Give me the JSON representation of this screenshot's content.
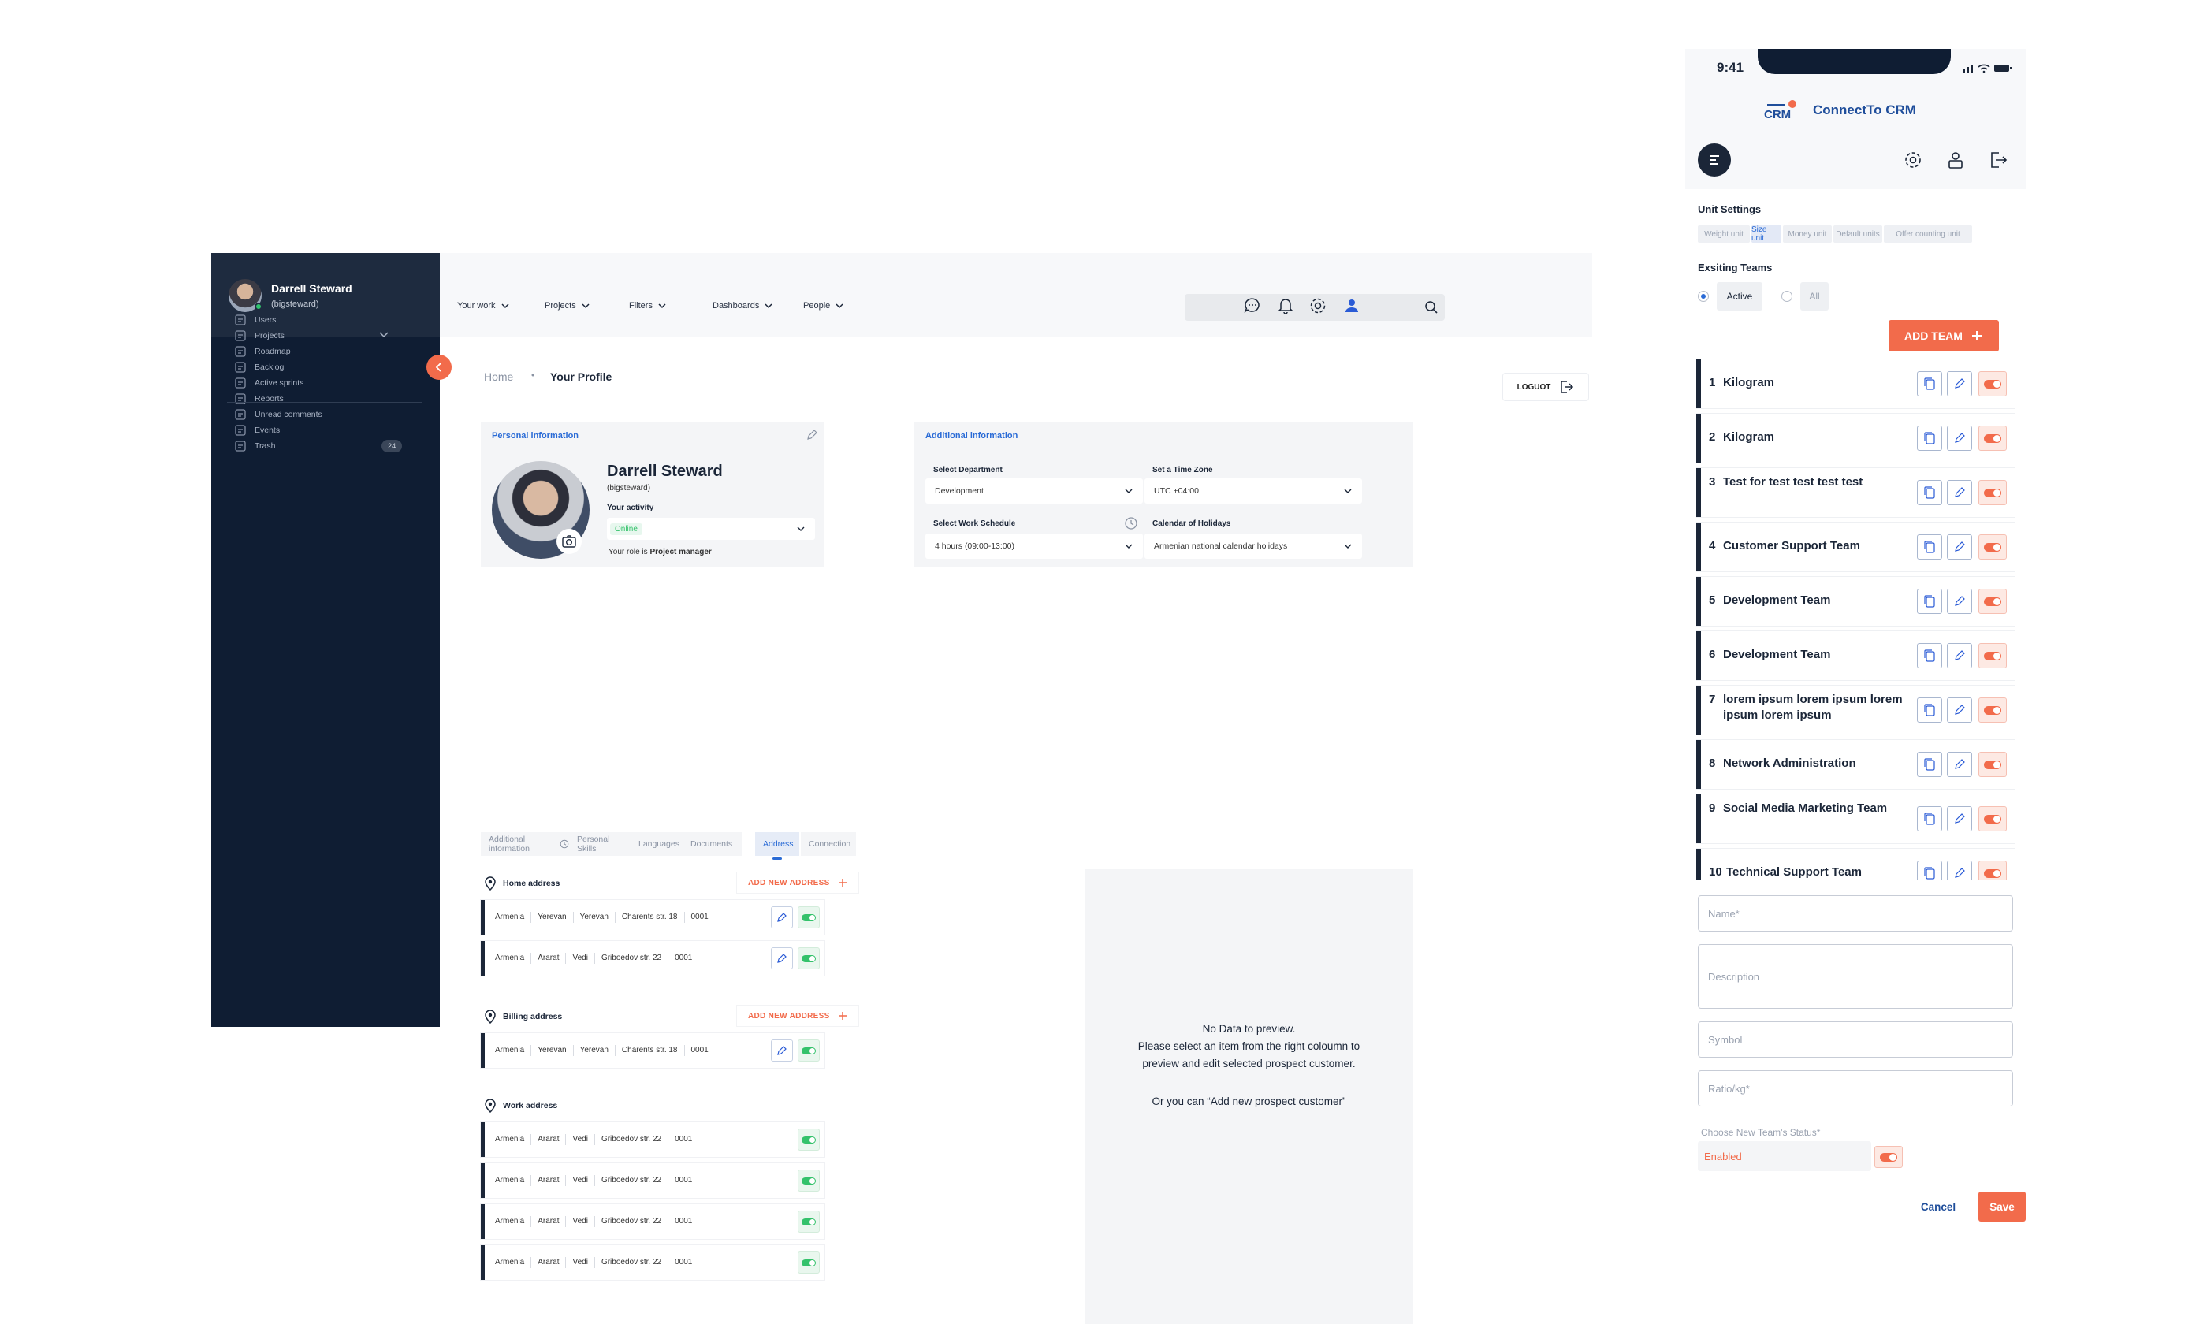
{
  "desktop": {
    "sidebar": {
      "user_name": "Darrell Steward",
      "user_handle": "(bigsteward)",
      "items": [
        {
          "label": "Users",
          "icon": "users-icon"
        },
        {
          "label": "Projects",
          "icon": "projects-icon"
        },
        {
          "label": "Roadmap",
          "icon": "roadmap-icon"
        },
        {
          "label": "Backlog",
          "icon": "backlog-icon"
        },
        {
          "label": "Active sprints",
          "icon": "sprints-icon"
        },
        {
          "label": "Reports",
          "icon": "reports-icon"
        },
        {
          "label": "Unread comments",
          "icon": "comments-icon"
        },
        {
          "label": "Events",
          "icon": "calendar-icon"
        },
        {
          "label": "Trash",
          "icon": "trash-icon",
          "badge": "24"
        }
      ]
    },
    "topbar": {
      "menu": [
        "Your work",
        "Projects",
        "Filters",
        "Dashboards",
        "People"
      ],
      "search_placeholder": ""
    },
    "breadcrumb": {
      "home": "Home",
      "separator": "•",
      "current": "Your Profile"
    },
    "logout_label": "LOGUOT",
    "personal": {
      "title": "Personal information",
      "name": "Darrell Steward",
      "handle": "(bigsteward)",
      "activity_label": "Your activity",
      "activity_value": "Online",
      "role_prefix": "Your role is ",
      "role": "Project manager"
    },
    "additional": {
      "title": "Additional information",
      "department_label": "Select Department",
      "department_value": "Development",
      "timezone_label": "Set a Time Zone",
      "timezone_value": "UTC +04:00",
      "schedule_label": "Select Work Schedule",
      "schedule_value": "4 hours (09:00-13:00)",
      "holidays_label": "Calendar of Holidays",
      "holidays_value": "Armenian national calendar holidays"
    },
    "tabs": [
      "Additional information",
      "Personal Skills",
      "Languages",
      "Documents",
      "Address",
      "Connection"
    ],
    "active_tab": "Address",
    "addresses": {
      "home_title": "Home address",
      "billing_title": "Billing address",
      "work_title": "Work address",
      "add_label": "ADD NEW ADDRESS",
      "home": [
        [
          "Armenia",
          "Yerevan",
          "Yerevan",
          "Charents str. 18",
          "0001"
        ],
        [
          "Armenia",
          "Ararat",
          "Vedi",
          "Griboedov str. 22",
          "0001"
        ]
      ],
      "billing": [
        [
          "Armenia",
          "Yerevan",
          "Yerevan",
          "Charents str. 18",
          "0001"
        ]
      ],
      "work": [
        [
          "Armenia",
          "Ararat",
          "Vedi",
          "Griboedov str. 22",
          "0001"
        ],
        [
          "Armenia",
          "Ararat",
          "Vedi",
          "Griboedov str. 22",
          "0001"
        ],
        [
          "Armenia",
          "Ararat",
          "Vedi",
          "Griboedov str. 22",
          "0001"
        ],
        [
          "Armenia",
          "Ararat",
          "Vedi",
          "Griboedov str. 22",
          "0001"
        ]
      ]
    },
    "preview": {
      "line1": "No Data to preview.",
      "line2": "Please select an item from the right coloumn to",
      "line3": "preview and edit selected prospect customer.",
      "line4": "Or you can “Add new prospect customer”"
    }
  },
  "phone": {
    "time": "9:41",
    "logo_text": "CRM",
    "app_title": "ConnectTo CRM",
    "unit_settings_title": "Unit Settings",
    "unit_tabs": [
      "Weight unit",
      "Size unit",
      "Money unit",
      "Default units",
      "Offer counting unit"
    ],
    "active_unit_tab": "Size unit",
    "teams_title": "Exsiting Teams",
    "filter_active": "Active",
    "filter_all": "All",
    "add_team_label": "ADD TEAM",
    "teams": [
      {
        "num": "1",
        "name": "Kilogram"
      },
      {
        "num": "2",
        "name": "Kilogram"
      },
      {
        "num": "3",
        "name": "Test for test test test test"
      },
      {
        "num": "4",
        "name": "Customer Support Team"
      },
      {
        "num": "5",
        "name": "Development Team"
      },
      {
        "num": "6",
        "name": "Development Team"
      },
      {
        "num": "7",
        "name": "lorem ipsum lorem ipsum lorem ipsum lorem ipsum"
      },
      {
        "num": "8",
        "name": "Network Administration"
      },
      {
        "num": "9",
        "name": "Social Media Marketing Team"
      },
      {
        "num": "10",
        "name": "Technical Support Team"
      }
    ],
    "form": {
      "name_placeholder": "Name*",
      "description_placeholder": "Description",
      "symbol_placeholder": "Symbol",
      "ratio_placeholder": "Ratio/kg*",
      "status_label": "Choose New Team's Status*",
      "status_value": "Enabled",
      "cancel_label": "Cancel",
      "save_label": "Save"
    },
    "colors": {
      "accent": "#f26b4b",
      "navy": "#1b2638",
      "link": "#2a6bd6",
      "success": "#34c26b"
    }
  }
}
